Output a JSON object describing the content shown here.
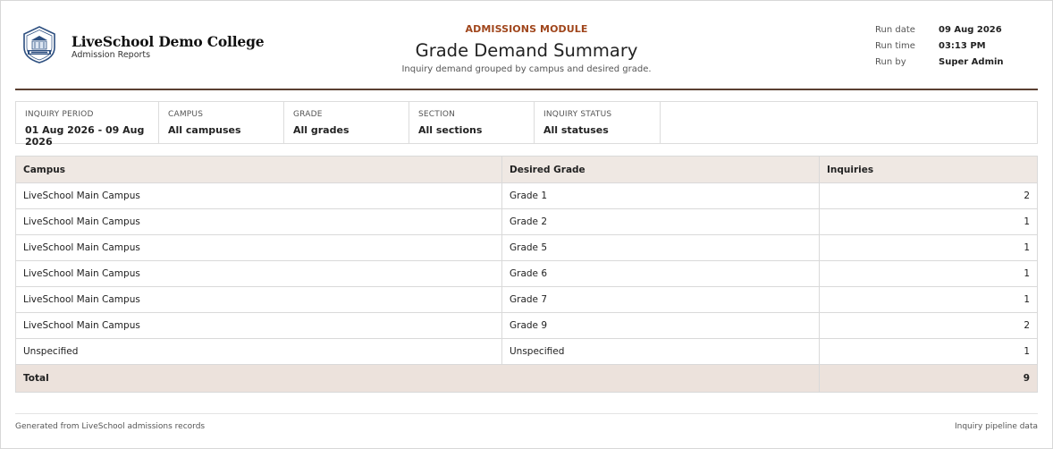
{
  "header": {
    "college_name": "LiveSchool Demo College",
    "college_subtitle": "Admission Reports",
    "module": "ADMISSIONS MODULE",
    "title": "Grade Demand Summary",
    "description": "Inquiry demand grouped by campus and desired grade.",
    "logo_icon": "school-crest-icon",
    "meta": [
      {
        "label": "Run date",
        "value": "09 Aug 2026"
      },
      {
        "label": "Run time",
        "value": "03:13 PM"
      },
      {
        "label": "Run by",
        "value": "Super Admin"
      }
    ]
  },
  "filters": [
    {
      "label": "INQUIRY PERIOD",
      "value": "01 Aug 2026 - 09 Aug 2026"
    },
    {
      "label": "CAMPUS",
      "value": "All campuses"
    },
    {
      "label": "GRADE",
      "value": "All grades"
    },
    {
      "label": "SECTION",
      "value": "All sections"
    },
    {
      "label": "INQUIRY STATUS",
      "value": "All statuses"
    }
  ],
  "table": {
    "columns": [
      "Campus",
      "Desired Grade",
      "Inquiries"
    ],
    "rows": [
      [
        "LiveSchool Main Campus",
        "Grade 1",
        "2"
      ],
      [
        "LiveSchool Main Campus",
        "Grade 2",
        "1"
      ],
      [
        "LiveSchool Main Campus",
        "Grade 5",
        "1"
      ],
      [
        "LiveSchool Main Campus",
        "Grade 6",
        "1"
      ],
      [
        "LiveSchool Main Campus",
        "Grade 7",
        "1"
      ],
      [
        "LiveSchool Main Campus",
        "Grade 9",
        "2"
      ],
      [
        "Unspecified",
        "Unspecified",
        "1"
      ]
    ],
    "total_label": "Total",
    "total_value": "9"
  },
  "footer": {
    "left": "Generated from LiveSchool admissions records",
    "right": "Inquiry pipeline data"
  },
  "colors": {
    "accent": "#a0461c",
    "header_rule": "#5a4032",
    "table_header_bg": "#efe8e3",
    "total_row_bg": "#ece2dc"
  }
}
